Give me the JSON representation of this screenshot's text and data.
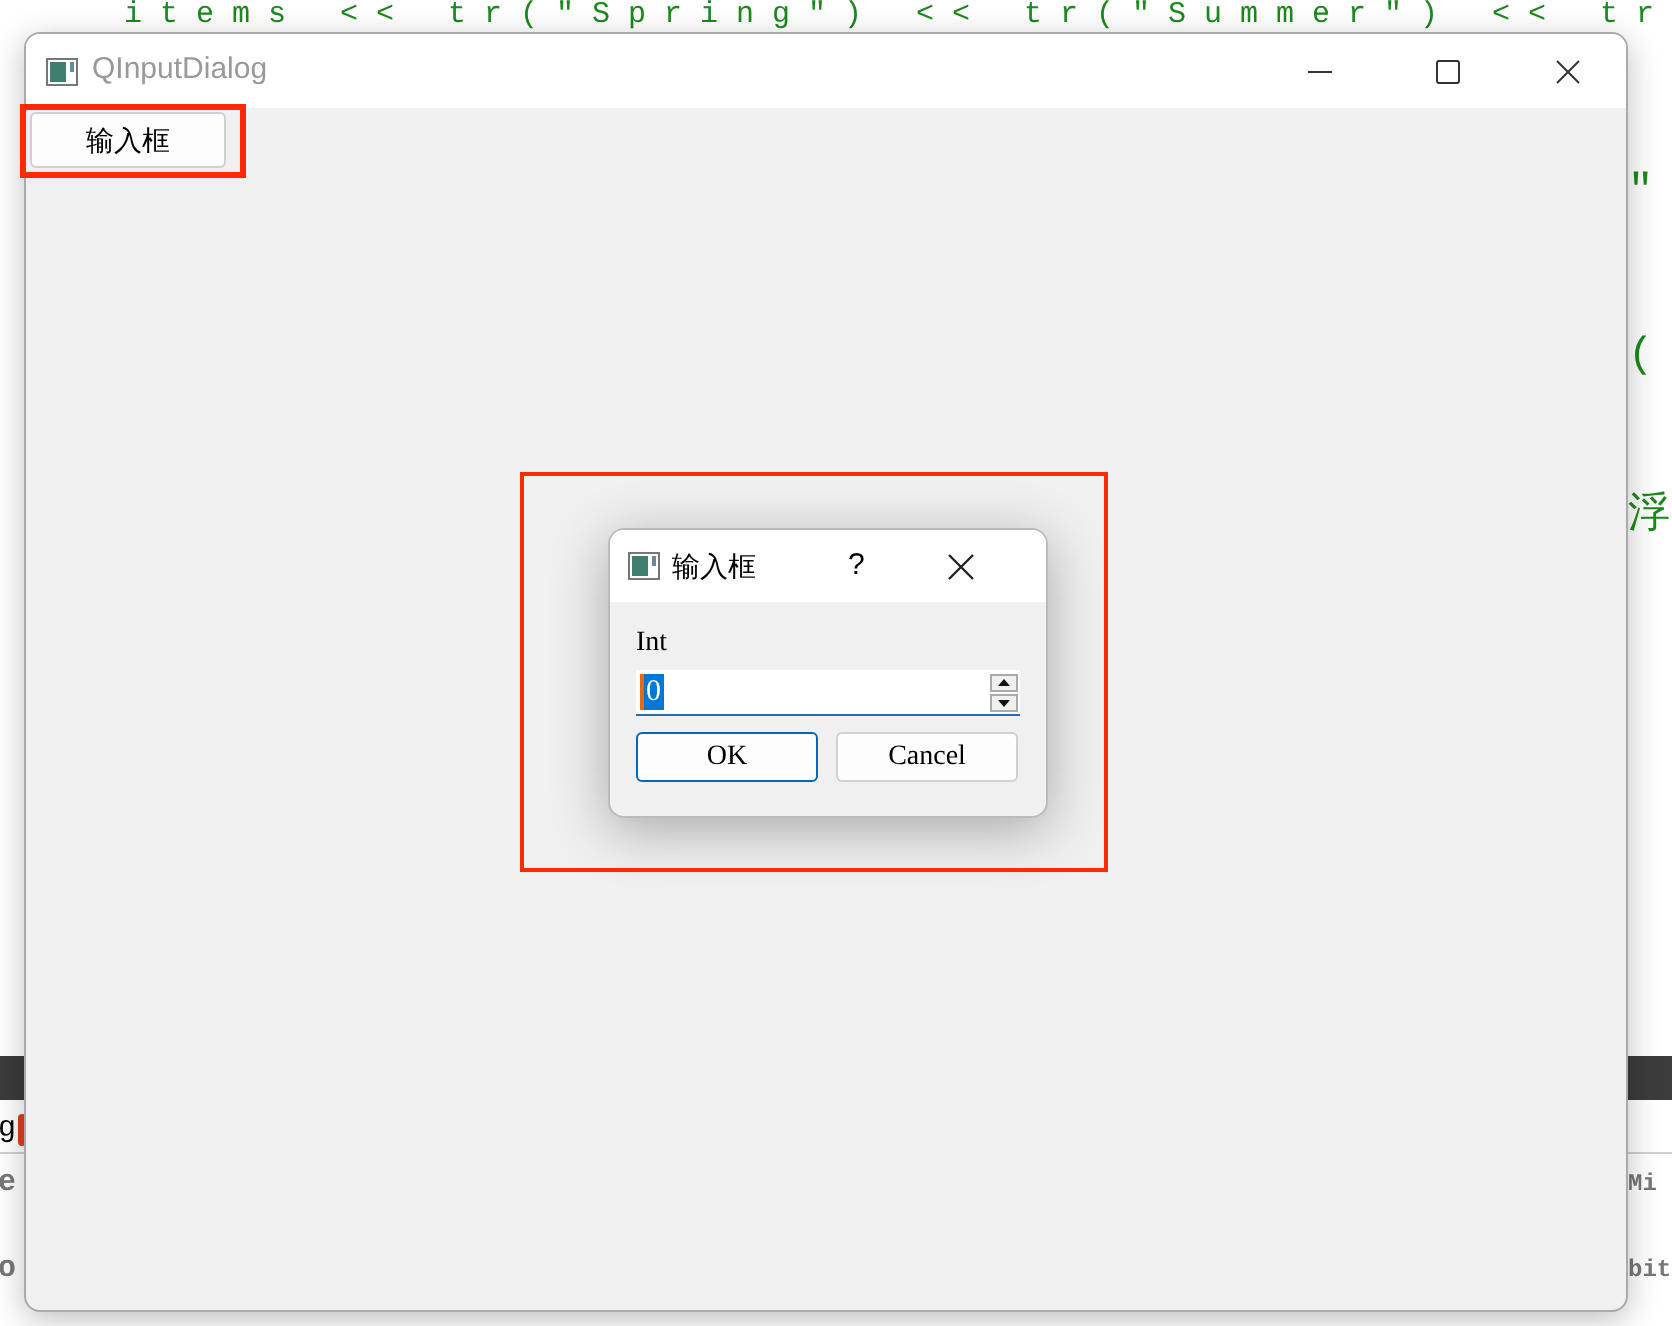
{
  "background": {
    "code_line": "items << tr(\"Spring\") << tr(\"Summer\") << tr",
    "right_fragments": [
      "\"",
      "(",
      "浮"
    ],
    "left_fragments": [
      "g",
      "e",
      "o"
    ],
    "right_bottom_fragments": [
      "Mi",
      "bit"
    ]
  },
  "window": {
    "title": "QInputDialog",
    "button": "输入框"
  },
  "dialog": {
    "title": "输入框",
    "help": "?",
    "label": "Int",
    "value": "0",
    "value_selected": true,
    "buttons": [
      {
        "label": "OK",
        "default": true
      },
      {
        "label": "Cancel",
        "default": false
      }
    ]
  }
}
